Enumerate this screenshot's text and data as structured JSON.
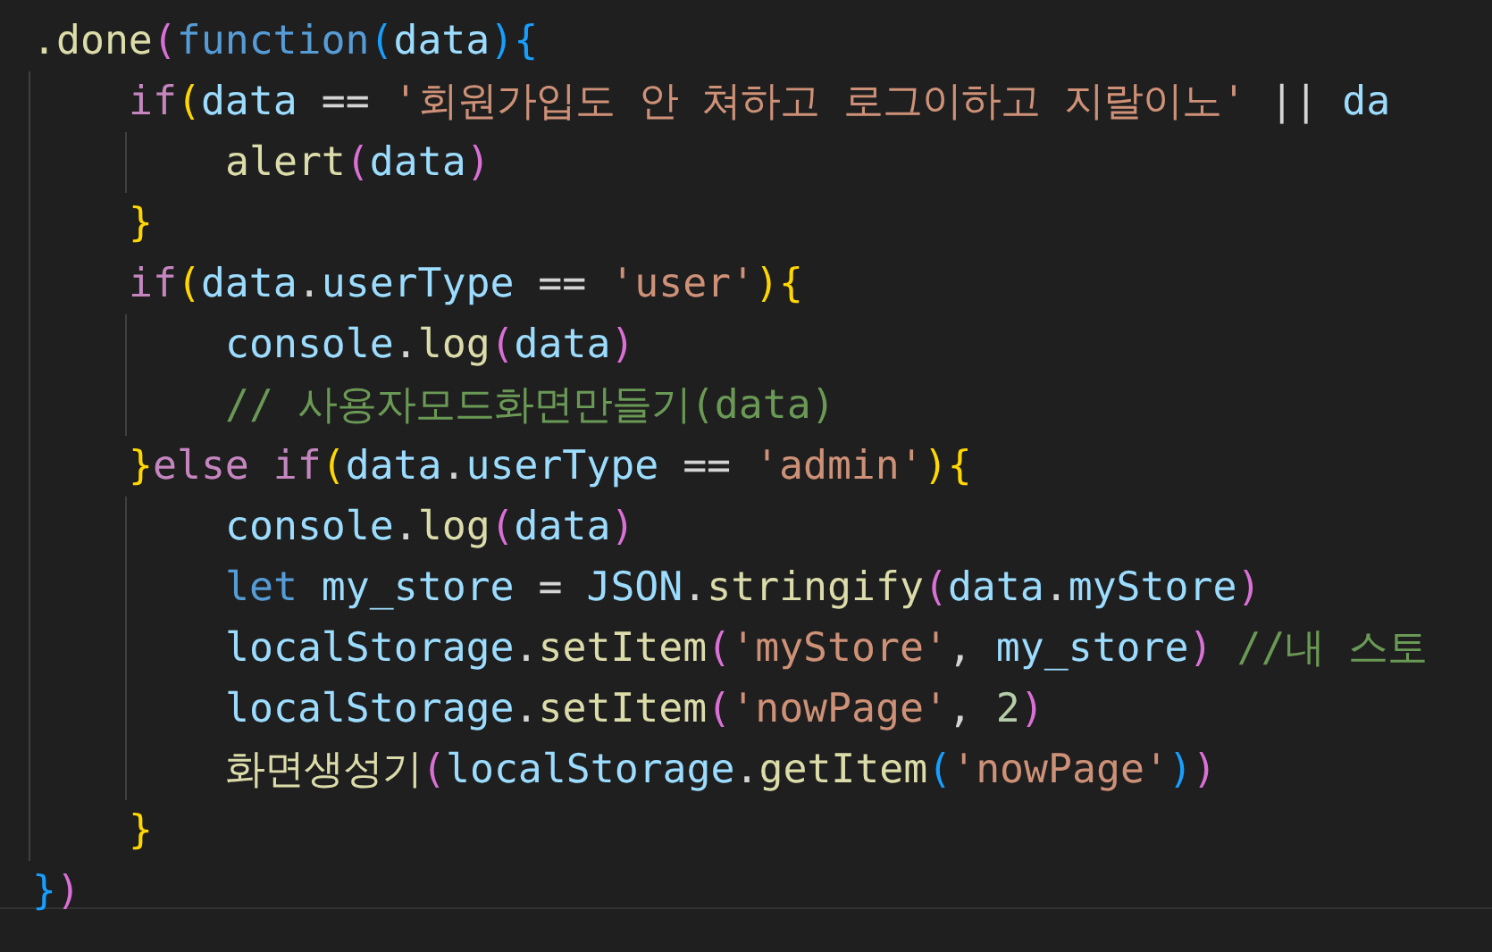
{
  "editor": {
    "lines": [
      {
        "tokens": [
          {
            "kind": "fn",
            "text": ".done"
          },
          {
            "kind": "b2",
            "text": "("
          },
          {
            "kind": "kw",
            "text": "function"
          },
          {
            "kind": "b3",
            "text": "("
          },
          {
            "kind": "var",
            "text": "data"
          },
          {
            "kind": "b3",
            "text": ")"
          },
          {
            "kind": "b3",
            "text": "{"
          }
        ],
        "children": [
          {
            "tokens": [
              {
                "kind": "ctl",
                "text": "if"
              },
              {
                "kind": "b1",
                "text": "("
              },
              {
                "kind": "var",
                "text": "data"
              },
              {
                "kind": "op",
                "text": " == "
              },
              {
                "kind": "str",
                "text": "'회원가입도 안 쳐하고 로그이하고 지랄이노'"
              },
              {
                "kind": "op",
                "text": " || "
              },
              {
                "kind": "var",
                "text": "da"
              }
            ],
            "children": [
              {
                "tokens": [
                  {
                    "kind": "fn",
                    "text": "alert"
                  },
                  {
                    "kind": "b2",
                    "text": "("
                  },
                  {
                    "kind": "var",
                    "text": "data"
                  },
                  {
                    "kind": "b2",
                    "text": ")"
                  }
                ]
              }
            ]
          },
          {
            "tokens": [
              {
                "kind": "b1",
                "text": "}"
              }
            ]
          },
          {
            "tokens": [
              {
                "kind": "ctl",
                "text": "if"
              },
              {
                "kind": "b1",
                "text": "("
              },
              {
                "kind": "var",
                "text": "data"
              },
              {
                "kind": "op",
                "text": "."
              },
              {
                "kind": "var",
                "text": "userType"
              },
              {
                "kind": "op",
                "text": " == "
              },
              {
                "kind": "str",
                "text": "'user'"
              },
              {
                "kind": "b1",
                "text": ")"
              },
              {
                "kind": "b1",
                "text": "{"
              }
            ],
            "children": [
              {
                "tokens": [
                  {
                    "kind": "var",
                    "text": "console"
                  },
                  {
                    "kind": "op",
                    "text": "."
                  },
                  {
                    "kind": "fn",
                    "text": "log"
                  },
                  {
                    "kind": "b2",
                    "text": "("
                  },
                  {
                    "kind": "var",
                    "text": "data"
                  },
                  {
                    "kind": "b2",
                    "text": ")"
                  }
                ]
              },
              {
                "tokens": [
                  {
                    "kind": "cmt",
                    "text": "// 사용자모드화면만들기(data)"
                  }
                ]
              }
            ]
          },
          {
            "tokens": [
              {
                "kind": "b1",
                "text": "}"
              },
              {
                "kind": "ctl",
                "text": "else "
              },
              {
                "kind": "ctl",
                "text": "if"
              },
              {
                "kind": "b1",
                "text": "("
              },
              {
                "kind": "var",
                "text": "data"
              },
              {
                "kind": "op",
                "text": "."
              },
              {
                "kind": "var",
                "text": "userType"
              },
              {
                "kind": "op",
                "text": " == "
              },
              {
                "kind": "str",
                "text": "'admin'"
              },
              {
                "kind": "b1",
                "text": ")"
              },
              {
                "kind": "b1",
                "text": "{"
              }
            ],
            "children": [
              {
                "tokens": [
                  {
                    "kind": "var",
                    "text": "console"
                  },
                  {
                    "kind": "op",
                    "text": "."
                  },
                  {
                    "kind": "fn",
                    "text": "log"
                  },
                  {
                    "kind": "b2",
                    "text": "("
                  },
                  {
                    "kind": "var",
                    "text": "data"
                  },
                  {
                    "kind": "b2",
                    "text": ")"
                  }
                ]
              },
              {
                "tokens": [
                  {
                    "kind": "kw",
                    "text": "let "
                  },
                  {
                    "kind": "var",
                    "text": "my_store"
                  },
                  {
                    "kind": "op",
                    "text": " = "
                  },
                  {
                    "kind": "var",
                    "text": "JSON"
                  },
                  {
                    "kind": "op",
                    "text": "."
                  },
                  {
                    "kind": "fn",
                    "text": "stringify"
                  },
                  {
                    "kind": "b2",
                    "text": "("
                  },
                  {
                    "kind": "var",
                    "text": "data"
                  },
                  {
                    "kind": "op",
                    "text": "."
                  },
                  {
                    "kind": "var",
                    "text": "myStore"
                  },
                  {
                    "kind": "b2",
                    "text": ")"
                  }
                ]
              },
              {
                "tokens": [
                  {
                    "kind": "var",
                    "text": "localStorage"
                  },
                  {
                    "kind": "op",
                    "text": "."
                  },
                  {
                    "kind": "fn",
                    "text": "setItem"
                  },
                  {
                    "kind": "b2",
                    "text": "("
                  },
                  {
                    "kind": "str",
                    "text": "'myStore'"
                  },
                  {
                    "kind": "op",
                    "text": ", "
                  },
                  {
                    "kind": "var",
                    "text": "my_store"
                  },
                  {
                    "kind": "b2",
                    "text": ")"
                  },
                  {
                    "kind": "cmt",
                    "text": " //내 스토"
                  }
                ]
              },
              {
                "tokens": [
                  {
                    "kind": "var",
                    "text": "localStorage"
                  },
                  {
                    "kind": "op",
                    "text": "."
                  },
                  {
                    "kind": "fn",
                    "text": "setItem"
                  },
                  {
                    "kind": "b2",
                    "text": "("
                  },
                  {
                    "kind": "str",
                    "text": "'nowPage'"
                  },
                  {
                    "kind": "op",
                    "text": ", "
                  },
                  {
                    "kind": "num",
                    "text": "2"
                  },
                  {
                    "kind": "b2",
                    "text": ")"
                  }
                ]
              },
              {
                "tokens": [
                  {
                    "kind": "fn",
                    "text": "화면생성기"
                  },
                  {
                    "kind": "b2",
                    "text": "("
                  },
                  {
                    "kind": "var",
                    "text": "localStorage"
                  },
                  {
                    "kind": "op",
                    "text": "."
                  },
                  {
                    "kind": "fn",
                    "text": "getItem"
                  },
                  {
                    "kind": "b3",
                    "text": "("
                  },
                  {
                    "kind": "str",
                    "text": "'nowPage'"
                  },
                  {
                    "kind": "b3",
                    "text": ")"
                  },
                  {
                    "kind": "b2",
                    "text": ")"
                  }
                ]
              }
            ]
          },
          {
            "tokens": [
              {
                "kind": "b1",
                "text": "}"
              }
            ]
          }
        ]
      },
      {
        "tokens": [
          {
            "kind": "b3",
            "text": "}"
          },
          {
            "kind": "b2",
            "text": ")"
          }
        ]
      }
    ]
  }
}
